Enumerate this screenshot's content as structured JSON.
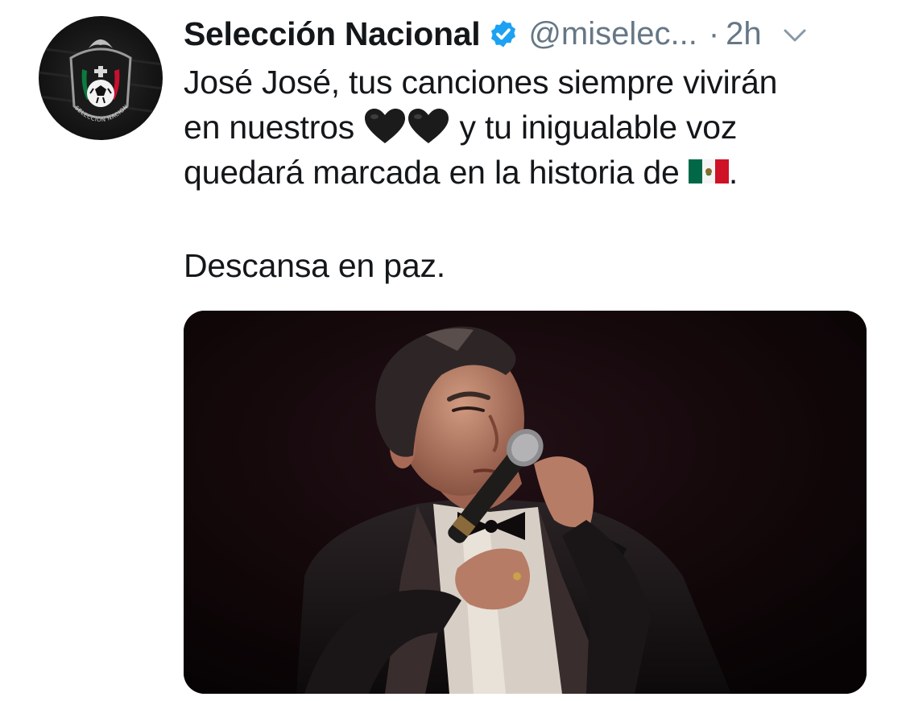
{
  "tweet": {
    "display_name": "Selección Nacional",
    "handle": "@miselec...",
    "separator": "·",
    "time": "2h",
    "text_lines": [
      "José José, tus canciones siempre vivirán",
      "en nuestros",
      "y tu inigualable voz",
      "quedará marcada en la historia de",
      "."
    ],
    "closing": "Descansa en paz.",
    "emojis": {
      "hearts": [
        "black-heart-icon",
        "black-heart-icon"
      ],
      "flag": "mexico-flag-icon"
    }
  },
  "avatar": {
    "logo_text": "SELECCIÓN NACIONAL DE MÉXICO"
  },
  "colors": {
    "text": "#14171a",
    "muted": "#657786",
    "verified": "#1da1f2",
    "flag_green": "#006847",
    "flag_red": "#ce1126"
  },
  "media": {
    "subject": "singer-with-microphone-photo"
  }
}
